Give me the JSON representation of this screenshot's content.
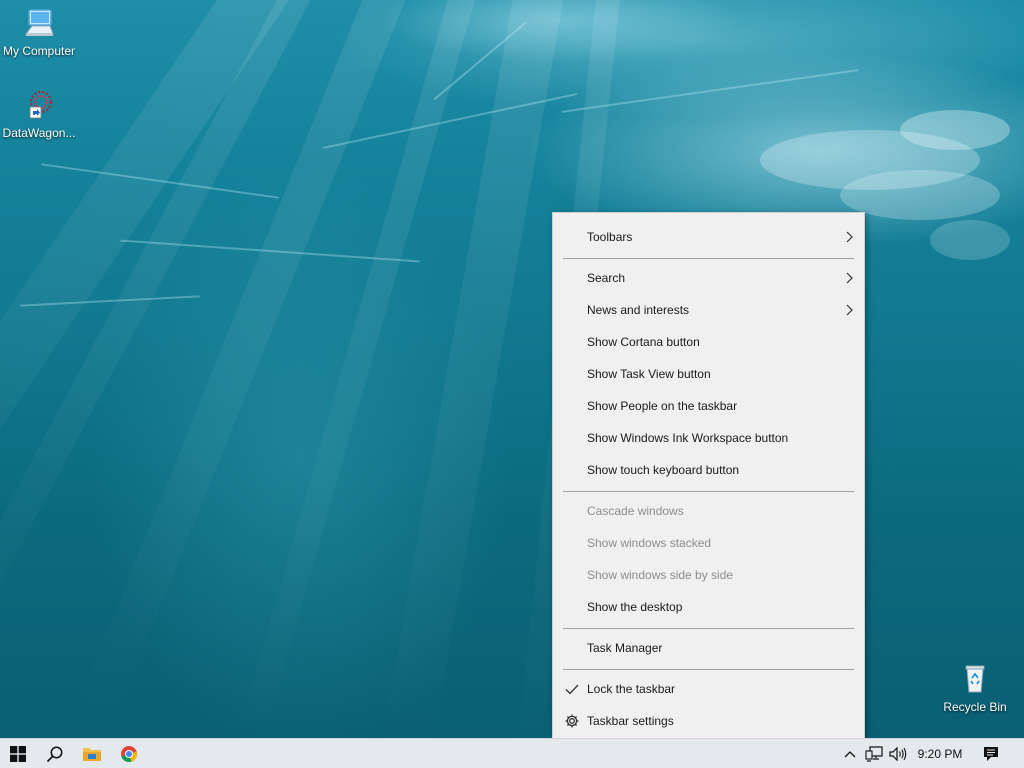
{
  "desktop": {
    "icons": [
      {
        "label": "My Computer",
        "icon": "computer-icon"
      },
      {
        "label": "DataWagon...",
        "icon": "datawagon-shortcut-icon"
      },
      {
        "label": "Recycle Bin",
        "icon": "recycle-bin-icon"
      }
    ]
  },
  "context_menu": {
    "items": [
      {
        "label": "Toolbars",
        "submenu": true,
        "enabled": true
      },
      {
        "label": "Search",
        "submenu": true,
        "enabled": true
      },
      {
        "label": "News and interests",
        "submenu": true,
        "enabled": true
      },
      {
        "label": "Show Cortana button",
        "enabled": true
      },
      {
        "label": "Show Task View button",
        "enabled": true
      },
      {
        "label": "Show People on the taskbar",
        "enabled": true
      },
      {
        "label": "Show Windows Ink Workspace button",
        "enabled": true
      },
      {
        "label": "Show touch keyboard button",
        "enabled": true
      },
      {
        "label": "Cascade windows",
        "enabled": false
      },
      {
        "label": "Show windows stacked",
        "enabled": false
      },
      {
        "label": "Show windows side by side",
        "enabled": false
      },
      {
        "label": "Show the desktop",
        "enabled": true
      },
      {
        "label": "Task Manager",
        "enabled": true
      },
      {
        "label": "Lock the taskbar",
        "enabled": true,
        "checked": true,
        "lead_icon": "checkmark-icon"
      },
      {
        "label": "Taskbar settings",
        "enabled": true,
        "lead_icon": "gear-icon"
      }
    ]
  },
  "taskbar": {
    "pinned": [
      {
        "name": "start-button",
        "icon": "windows-logo-icon"
      },
      {
        "name": "search-button",
        "icon": "search-icon"
      },
      {
        "name": "file-explorer-button",
        "icon": "folder-icon"
      },
      {
        "name": "chrome-button",
        "icon": "chrome-icon"
      }
    ],
    "tray": {
      "icons": [
        "chevron-up-icon",
        "network-icon",
        "volume-icon"
      ],
      "clock": "9:20 PM",
      "notification_icon": "action-center-icon"
    }
  },
  "colors": {
    "menu_bg": "#f0f0f0",
    "menu_disabled_text": "#8d8d8d",
    "taskbar_bg": "#e4e9ee",
    "wallpaper_base": "#11788f"
  }
}
